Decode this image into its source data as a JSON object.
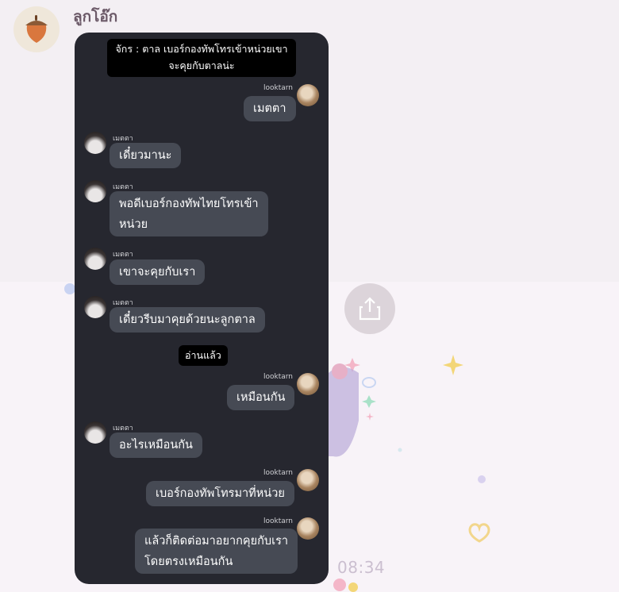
{
  "chat": {
    "name": "ลูกโอ๊ก",
    "avatar_icon": "acorn-icon"
  },
  "card": {
    "header_note": "จักร : ตาล เบอร์กองทัพโทรเข้าหน่วยเขาจะคุยกับตาลน่ะ",
    "read_note": "อ่านแล้ว",
    "messages": [
      {
        "side": "right",
        "sender": "looktarn",
        "text": "เมตตา"
      },
      {
        "side": "left",
        "sender": "เมตตา",
        "text": "เดี๋ยวมานะ"
      },
      {
        "side": "left",
        "sender": "เมตตา",
        "text_line1": "พอดีเบอร์กองทัพไทยโทรเข้า",
        "text_line2": "หน่วย"
      },
      {
        "side": "left",
        "sender": "เมตตา",
        "text": "เขาจะคุยกับเรา"
      },
      {
        "side": "left",
        "sender": "เมตตา",
        "text": "เดี๋ยวรีบมาคุยด้วยนะลูกตาล"
      },
      {
        "side": "right",
        "sender": "looktarn",
        "text": "เหมือนกัน"
      },
      {
        "side": "left",
        "sender": "เมตตา",
        "text": "อะไรเหมือนกัน"
      },
      {
        "side": "right",
        "sender": "looktarn",
        "text": "เบอร์กองทัพโทรมาที่หน่วย"
      },
      {
        "side": "right",
        "sender": "looktarn",
        "text_line1": "แล้วก็ติดต่อมาอยากคุยกับเรา",
        "text_line2": "โดยตรงเหมือนกัน"
      }
    ]
  },
  "share_button": {
    "icon": "share-icon"
  },
  "time": "08:34",
  "colors": {
    "card_bg": "#26272f",
    "bubble_bg": "#464a54",
    "note_bg": "#000000",
    "page_bg": "#f4eff4"
  }
}
